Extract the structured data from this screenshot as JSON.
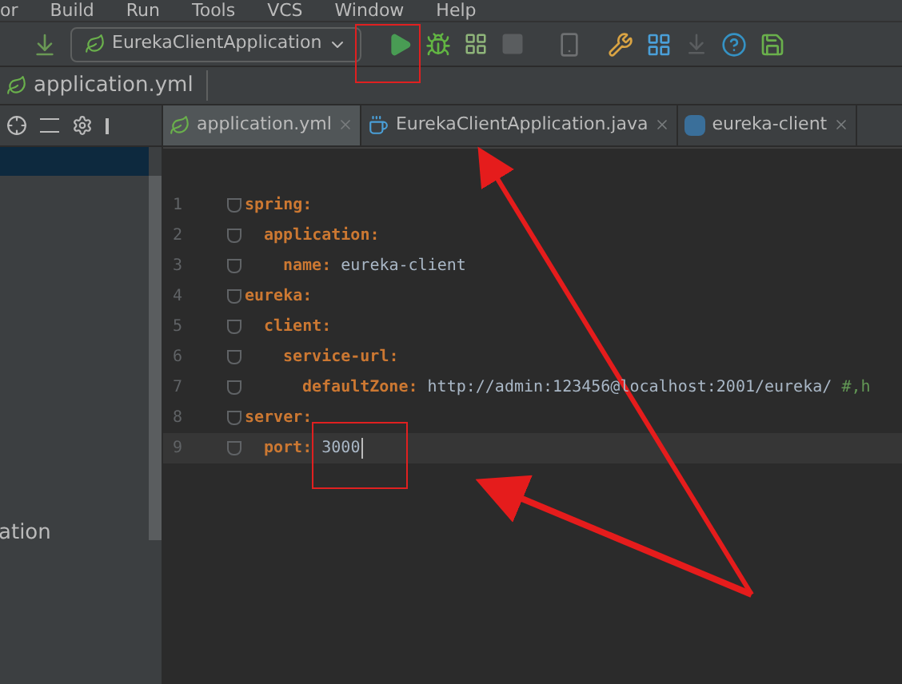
{
  "menu_bar": [
    "or",
    "Build",
    "Run",
    "Tools",
    "VCS",
    "Window",
    "Help"
  ],
  "toolbar": {
    "run_config": "EurekaClientApplication",
    "stop_disabled": true
  },
  "breadcrumb": "application.yml",
  "project_panel": {
    "visible_text": "ation"
  },
  "tabs": [
    {
      "label": "application.yml",
      "kind": "yaml",
      "selected": true
    },
    {
      "label": "EurekaClientApplication.java",
      "kind": "java",
      "selected": false
    },
    {
      "label": "eureka-client",
      "kind": "maven",
      "selected": false
    }
  ],
  "editor": {
    "lines": [
      {
        "number": "1",
        "key": "spring:",
        "children": [
          {
            "number": "2",
            "key": "application:",
            "children": [
              {
                "number": "3",
                "key": "name:",
                "value": "eureka-client"
              }
            ]
          }
        ]
      },
      {
        "number": "4",
        "key": "eureka:",
        "children": [
          {
            "number": "5",
            "key": "client:",
            "children": [
              {
                "number": "6",
                "key": "service-url:",
                "children": [
                  {
                    "number": "7",
                    "key": "defaultZone:",
                    "value": "http://admin:123456@localhost:2001/eureka/",
                    "comment": "#,h"
                  }
                ]
              }
            ]
          }
        ]
      },
      {
        "number": "8",
        "key": "server:",
        "children": [
          {
            "number": "9",
            "key": "port:",
            "value": "3000",
            "current": true
          }
        ]
      }
    ]
  }
}
